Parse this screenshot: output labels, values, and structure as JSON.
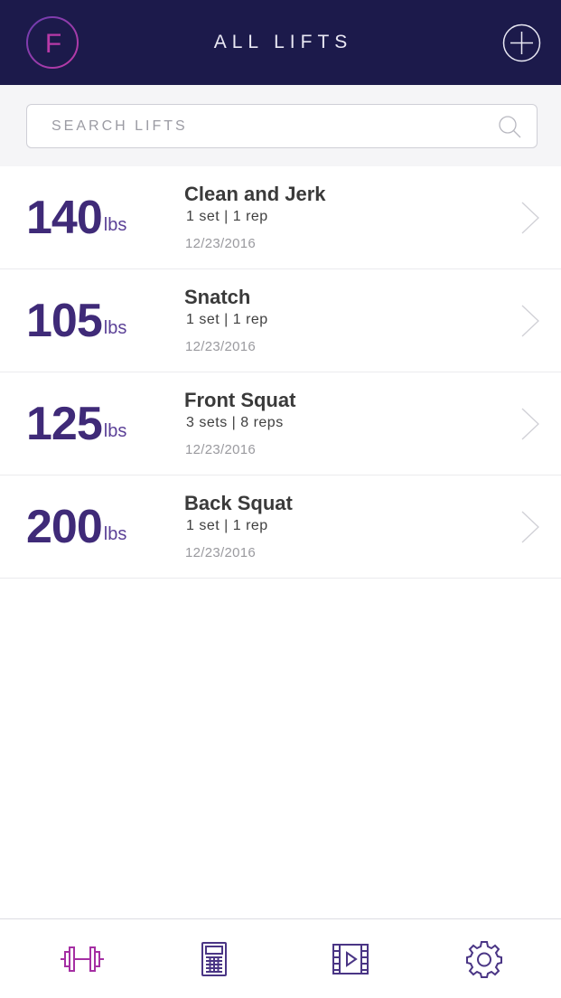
{
  "header": {
    "title": "ALL LIFTS",
    "logo_letter": "F",
    "logo_icon": "f-logo-icon",
    "add_icon": "plus-circle-icon"
  },
  "search": {
    "placeholder": "SEARCH LIFTS",
    "value": "",
    "icon": "search-icon"
  },
  "lifts": [
    {
      "weight": "140",
      "unit": "lbs",
      "name": "Clean and Jerk",
      "sets_reps": "1 set  |  1 rep",
      "date": "12/23/2016"
    },
    {
      "weight": "105",
      "unit": "lbs",
      "name": "Snatch",
      "sets_reps": "1 set  |  1 rep",
      "date": "12/23/2016"
    },
    {
      "weight": "125",
      "unit": "lbs",
      "name": "Front Squat",
      "sets_reps": "3 sets  |  8 reps",
      "date": "12/23/2016"
    },
    {
      "weight": "200",
      "unit": "lbs",
      "name": "Back Squat",
      "sets_reps": "1 set  |  1 rep",
      "date": "12/23/2016"
    }
  ],
  "tabbar": {
    "tabs": [
      {
        "icon": "barbell-icon",
        "active": true
      },
      {
        "icon": "calculator-icon",
        "active": false
      },
      {
        "icon": "video-icon",
        "active": false
      },
      {
        "icon": "gear-icon",
        "active": false
      }
    ]
  },
  "colors": {
    "header_bg": "#1c1a4b",
    "accent_purple": "#3f2a78",
    "active_tab": "#a52fa3",
    "inactive_tab": "#4a3585"
  }
}
